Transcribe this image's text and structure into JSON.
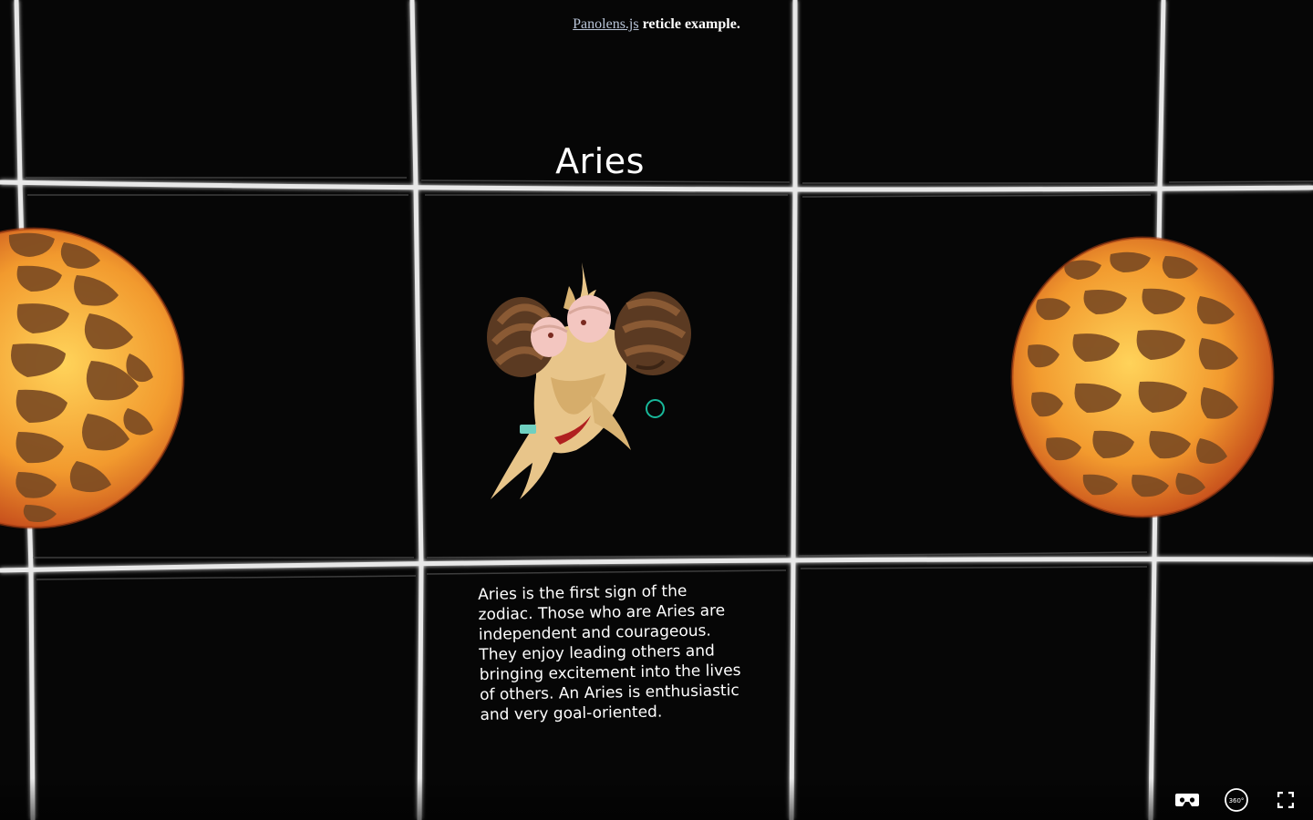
{
  "header": {
    "link_text": "Panolens.js",
    "rest_text": " reticle example."
  },
  "infospot": {
    "title": "Aries",
    "description": "Aries is the first sign of the zodiac. Those who are Aries are independent and courageous. They enjoy leading others and bringing excitement into the lives of others. An Aries is enthusiastic and very goal-oriented."
  },
  "controls": {
    "vr_icon": "cardboard-vr-icon",
    "view_icon": "360-view-icon",
    "view_label": "360°",
    "fullscreen_icon": "fullscreen-icon"
  },
  "colors": {
    "background": "#060606",
    "grid_line": "#e8e8e8",
    "reticle": "#18b89a",
    "sphere_light": "#f6b23a",
    "sphere_dark": "#7a4a22"
  }
}
